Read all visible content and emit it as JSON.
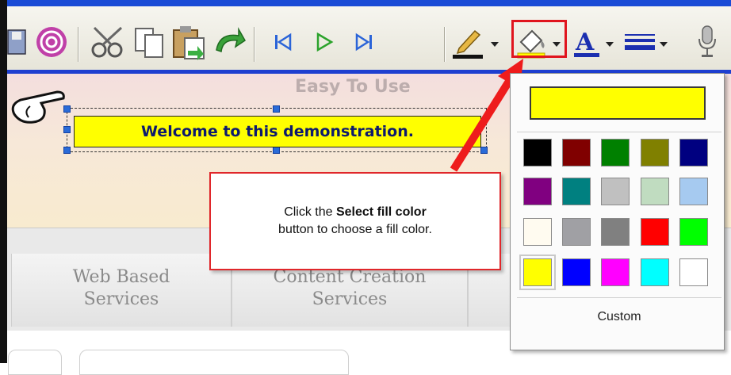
{
  "toolbar": {
    "icons": [
      "save-icon",
      "spiral-icon",
      "cut-icon",
      "copy-icon",
      "paste-icon",
      "undo-icon",
      "first-slide-icon",
      "play-icon",
      "last-slide-icon",
      "line-color-icon",
      "fill-color-icon",
      "font-color-icon",
      "line-style-icon",
      "microphone-icon"
    ]
  },
  "canvas": {
    "banner_text": "Easy To Use",
    "selected_text": "Welcome to this demonstration."
  },
  "callout": {
    "prefix": "Click the ",
    "bold": "Select fill color",
    "suffix": "button to choose a fill color."
  },
  "nav": {
    "item1": "Web Based\nServices",
    "item2": "Content Creation\nServices"
  },
  "fill_popup": {
    "current_color": "#ffff00",
    "swatches": [
      "#000000",
      "#800000",
      "#008000",
      "#808000",
      "#000080",
      "#800080",
      "#008080",
      "#c0c0c0",
      "#c0dcc0",
      "#a6caf0",
      "#fffbf0",
      "#a0a0a4",
      "#808080",
      "#ff0000",
      "#00ff00",
      "#ffff00",
      "#0000ff",
      "#ff00ff",
      "#00ffff",
      "#ffffff"
    ],
    "selected_index": 15,
    "custom_label": "Custom"
  },
  "colors": {
    "highlight_red": "#e0141e",
    "toolbar_blue": "#1e3fd0"
  }
}
